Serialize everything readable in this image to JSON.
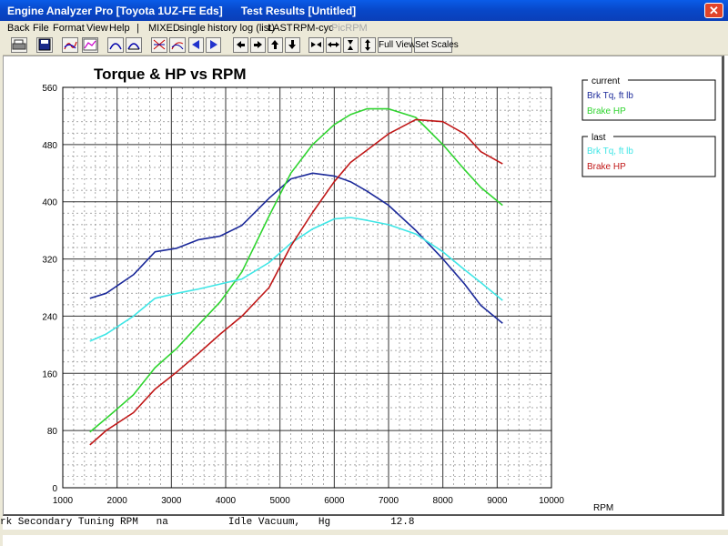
{
  "window": {
    "title": "Engine Analyzer Pro [Toyota 1UZ-FE Eds]      Test Results [Untitled]",
    "close_glyph": "✕"
  },
  "menu": {
    "items": [
      "Back",
      "File",
      "Format",
      "View",
      "Help",
      "|",
      "MIXED",
      "single",
      "history log (list)",
      "LAST",
      "RPM-cyc",
      "PicRPM"
    ],
    "disabled": [
      "PicRPM"
    ]
  },
  "toolbar": {
    "full_view": "Full View",
    "set_scales": "Set Scales"
  },
  "status_line": "rk Secondary Tuning RPM   na          Idle Vacuum,   Hg          12.8",
  "chart_data": {
    "type": "line",
    "title": "Torque & HP vs RPM",
    "xlabel": "RPM",
    "ylabel": "",
    "xlim": [
      1000,
      10000
    ],
    "ylim": [
      0,
      560
    ],
    "x_ticks": [
      1000,
      2000,
      3000,
      4000,
      5000,
      6000,
      7000,
      8000,
      9000,
      10000
    ],
    "y_ticks": [
      0,
      80,
      160,
      240,
      320,
      400,
      480,
      560
    ],
    "grid": true,
    "legend_groups": [
      {
        "title": "current",
        "entries": [
          "Brk Tq, ft lb",
          "Brake HP"
        ]
      },
      {
        "title": "last",
        "entries": [
          "Brk Tq, ft lb",
          "Brake HP"
        ]
      }
    ],
    "series": [
      {
        "name": "Brk Tq, ft lb",
        "group": "current",
        "color": "#1c2a9a",
        "x": [
          1500,
          1800,
          2300,
          2700,
          3100,
          3500,
          3900,
          4300,
          4800,
          5200,
          5600,
          6000,
          6300,
          6600,
          7000,
          7500,
          8000,
          8400,
          8700,
          9100
        ],
        "y": [
          265,
          272,
          298,
          330,
          335,
          347,
          352,
          367,
          405,
          432,
          440,
          436,
          428,
          415,
          395,
          360,
          320,
          285,
          255,
          230
        ]
      },
      {
        "name": "Brake HP",
        "group": "current",
        "color": "#2fd42f",
        "x": [
          1500,
          1800,
          2300,
          2700,
          3100,
          3500,
          3900,
          4300,
          4800,
          5200,
          5600,
          6000,
          6300,
          6600,
          7000,
          7500,
          8000,
          8400,
          8700,
          9100
        ],
        "y": [
          78,
          97,
          130,
          168,
          195,
          228,
          260,
          302,
          380,
          440,
          480,
          508,
          522,
          530,
          530,
          518,
          480,
          445,
          420,
          395
        ]
      },
      {
        "name": "Brk Tq, ft lb",
        "group": "last",
        "color": "#3fe6e6",
        "x": [
          1500,
          1800,
          2300,
          2700,
          3100,
          3500,
          3900,
          4300,
          4800,
          5200,
          5600,
          6000,
          6300,
          6600,
          7000,
          7500,
          8000,
          8400,
          8700,
          9100
        ],
        "y": [
          205,
          215,
          240,
          265,
          272,
          278,
          285,
          292,
          315,
          342,
          362,
          376,
          378,
          374,
          368,
          355,
          330,
          305,
          287,
          262
        ]
      },
      {
        "name": "Brake HP",
        "group": "last",
        "color": "#c01818",
        "x": [
          1500,
          1800,
          2300,
          2700,
          3100,
          3500,
          3900,
          4300,
          4800,
          5200,
          5600,
          6000,
          6300,
          6600,
          7000,
          7500,
          8000,
          8400,
          8700,
          9100
        ],
        "y": [
          60,
          80,
          105,
          138,
          162,
          188,
          215,
          240,
          280,
          338,
          385,
          428,
          455,
          472,
          495,
          515,
          512,
          495,
          470,
          453
        ]
      }
    ]
  },
  "colors": {
    "titlebar": "#0a5ce8",
    "chrome": "#ece9d8",
    "plot_bg": "#ffffff"
  }
}
